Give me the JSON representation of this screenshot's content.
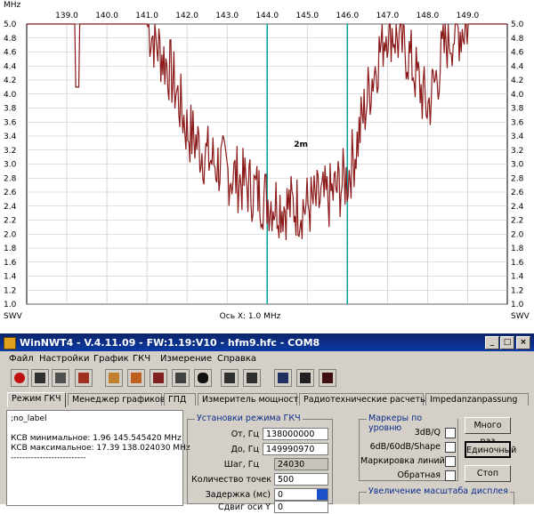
{
  "plot": {
    "x_unit": "MHz",
    "x_ticks": [
      "139.0",
      "140.0",
      "141.0",
      "142.0",
      "143.0",
      "144.0",
      "145.0",
      "146.0",
      "147.0",
      "148.0",
      "149.0"
    ],
    "y_ticks": [
      "5.0",
      "4.8",
      "4.6",
      "4.4",
      "4.2",
      "4.0",
      "3.8",
      "3.6",
      "3.4",
      "3.2",
      "3.0",
      "2.8",
      "2.6",
      "2.4",
      "2.2",
      "2.0",
      "1.8",
      "1.6",
      "1.4",
      "1.2",
      "1.0"
    ],
    "y_unit": "SWV",
    "x_axis_label": "Ось X: 1.0 MHz",
    "marker_label": "2m",
    "colors": {
      "trace": "#8b1a1a",
      "marker": "#00a0a0",
      "grid": "#c0c0c0"
    }
  },
  "chart_data": {
    "type": "line",
    "series": [
      {
        "x": [
          138.0,
          139.0,
          140.0,
          141.0,
          141.6,
          142.0,
          142.5,
          143.0,
          143.5,
          144.0,
          144.5,
          145.0,
          145.5,
          146.0,
          146.2,
          146.6,
          147.0,
          147.5,
          148.0,
          148.5,
          149.0,
          149.99
        ],
        "y": [
          5.0,
          5.0,
          5.0,
          5.0,
          4.3,
          3.5,
          3.1,
          2.9,
          2.7,
          2.5,
          2.4,
          2.4,
          2.5,
          2.8,
          3.2,
          4.2,
          5.0,
          4.6,
          3.8,
          4.8,
          5.0,
          5.0
        ]
      }
    ],
    "xlim": [
      138.0,
      149.99
    ],
    "ylim": [
      1.0,
      5.0
    ],
    "markers": [
      {
        "x": 144.0
      },
      {
        "x": 146.0
      }
    ]
  },
  "window": {
    "title": "WinNWT4 - V.4.11.09 - FW:1.19:V10 - hfm9.hfc - COM8",
    "btn_min": "_",
    "btn_max": "□",
    "btn_close": "×"
  },
  "menu": [
    "Файл",
    "Настройки",
    "График",
    "ГКЧ",
    "Измерение",
    "Справка"
  ],
  "toolbar_icons": [
    "power-icon",
    "sweep-icon",
    "tool-icon",
    "chart-icon",
    "graph-icon",
    "bug-icon",
    "penguin-icon",
    "calibrate-icon",
    "calibrate2-icon",
    "probe-icon",
    "save-icon",
    "stop-icon"
  ],
  "tabs": [
    "Режим ГКЧ",
    "Менеджер графиков",
    "ГПД",
    "Измеритель мощности",
    "Радиотехнические расчеты",
    "Impedanzanpassung"
  ],
  "memo": {
    "line1": ";no_label",
    "line2": "КСВ минимальное: 1.96  145.545420 MHz",
    "line3": "КСВ максимальное: 17.39  138.024030 MHz",
    "line4": "--------------------------"
  },
  "settings": {
    "caption": "Установки режима ГКЧ",
    "from_label": "От, Гц",
    "from_value": "138000000",
    "to_label": "До, Гц",
    "to_value": "149990970",
    "step_label": "Шаг, Гц",
    "step_value": "24030",
    "points_label": "Количество точек",
    "points_value": "500",
    "delay_label": "Задержка (мс)",
    "delay_value": "0",
    "shift_label": "Сдвиг оси Y",
    "shift_value": "0"
  },
  "markers_group": {
    "caption": "Маркеры по уровню",
    "opt1": "3dB/Q",
    "opt2": "6dB/60dB/Shape",
    "opt3": "Маркировка линий",
    "opt4": "Обратная"
  },
  "zoom_group": {
    "caption": "Увеличение масштаба дисплея"
  },
  "buttons": {
    "multi": "Много раз",
    "single": "Единочный",
    "stop": "Стоп"
  }
}
